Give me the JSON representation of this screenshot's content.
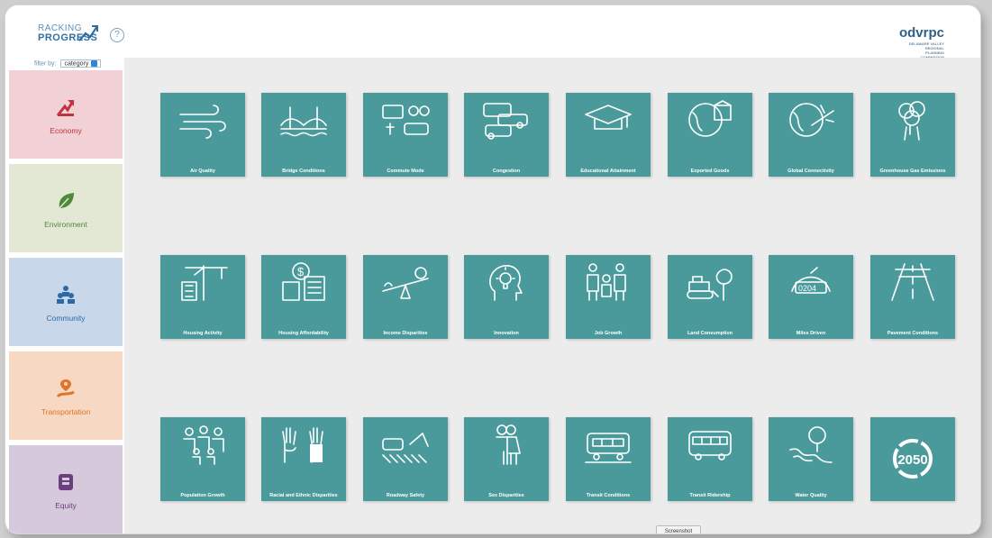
{
  "header": {
    "logo_line1": "RACKING",
    "logo_line2": "PROGRESS",
    "help_symbol": "?",
    "org_logo": "odvrpc",
    "org_tag": "DELAWARE VALLEY REGIONAL PLANNING COMMISSION"
  },
  "filter": {
    "label": "filter by:",
    "value": "category"
  },
  "categories": [
    {
      "label": "Economy",
      "icon": "growth-arrow-icon",
      "bg": "#f1d0d6",
      "color": "#c0343f"
    },
    {
      "label": "Environment",
      "icon": "leaf-icon",
      "bg": "#e2e8d4",
      "color": "#4e8a3c"
    },
    {
      "label": "Community",
      "icon": "people-blocks-icon",
      "bg": "#c8d7ea",
      "color": "#2d6aa5"
    },
    {
      "label": "Transportation",
      "icon": "map-pin-road-icon",
      "bg": "#f7d8c3",
      "color": "#e07428"
    },
    {
      "label": "Equity",
      "icon": "scales-hand-icon",
      "bg": "#d7c9dc",
      "color": "#6b3e7c"
    }
  ],
  "indicators": [
    {
      "label": "Air Quality",
      "icon": "wind-icon"
    },
    {
      "label": "Bridge Conditions",
      "icon": "bridge-icon"
    },
    {
      "label": "Commute Mode",
      "icon": "commute-vehicles-icon"
    },
    {
      "label": "Congestion",
      "icon": "traffic-cars-icon"
    },
    {
      "label": "Educational Attainment",
      "icon": "graduation-cap-icon"
    },
    {
      "label": "Exported Goods",
      "icon": "globe-box-icon"
    },
    {
      "label": "Global Connectivity",
      "icon": "globe-plane-icon"
    },
    {
      "label": "Greenhouse Gas Emissions",
      "icon": "smoke-stack-icon"
    },
    {
      "label": "Housing Activity",
      "icon": "crane-building-icon"
    },
    {
      "label": "Housing Affordability",
      "icon": "dollar-buildings-icon"
    },
    {
      "label": "Income Disparities",
      "icon": "seesaw-money-icon"
    },
    {
      "label": "Innovation",
      "icon": "head-lightbulb-icon"
    },
    {
      "label": "Job Growth",
      "icon": "workers-icon"
    },
    {
      "label": "Land Consumption",
      "icon": "bulldozer-tree-icon"
    },
    {
      "label": "Miles Driven",
      "icon": "odometer-icon"
    },
    {
      "label": "Pavement Conditions",
      "icon": "road-icon"
    },
    {
      "label": "Population Growth",
      "icon": "crowd-icon"
    },
    {
      "label": "Racial and Ethnic Disparities",
      "icon": "raised-hands-icon"
    },
    {
      "label": "Roadway Safety",
      "icon": "crosswalk-crash-icon"
    },
    {
      "label": "Sex Disparities",
      "icon": "man-woman-icon"
    },
    {
      "label": "Transit Conditions",
      "icon": "train-icon"
    },
    {
      "label": "Transit Ridership",
      "icon": "bus-icon"
    },
    {
      "label": "Water Quality",
      "icon": "tree-river-icon"
    },
    {
      "label": "",
      "icon": "plan-2050-icon",
      "badge_text": "2050"
    }
  ],
  "tooltip": "Screenshot",
  "colors": {
    "tile": "#4b9a9b",
    "panel": "#ececec"
  }
}
